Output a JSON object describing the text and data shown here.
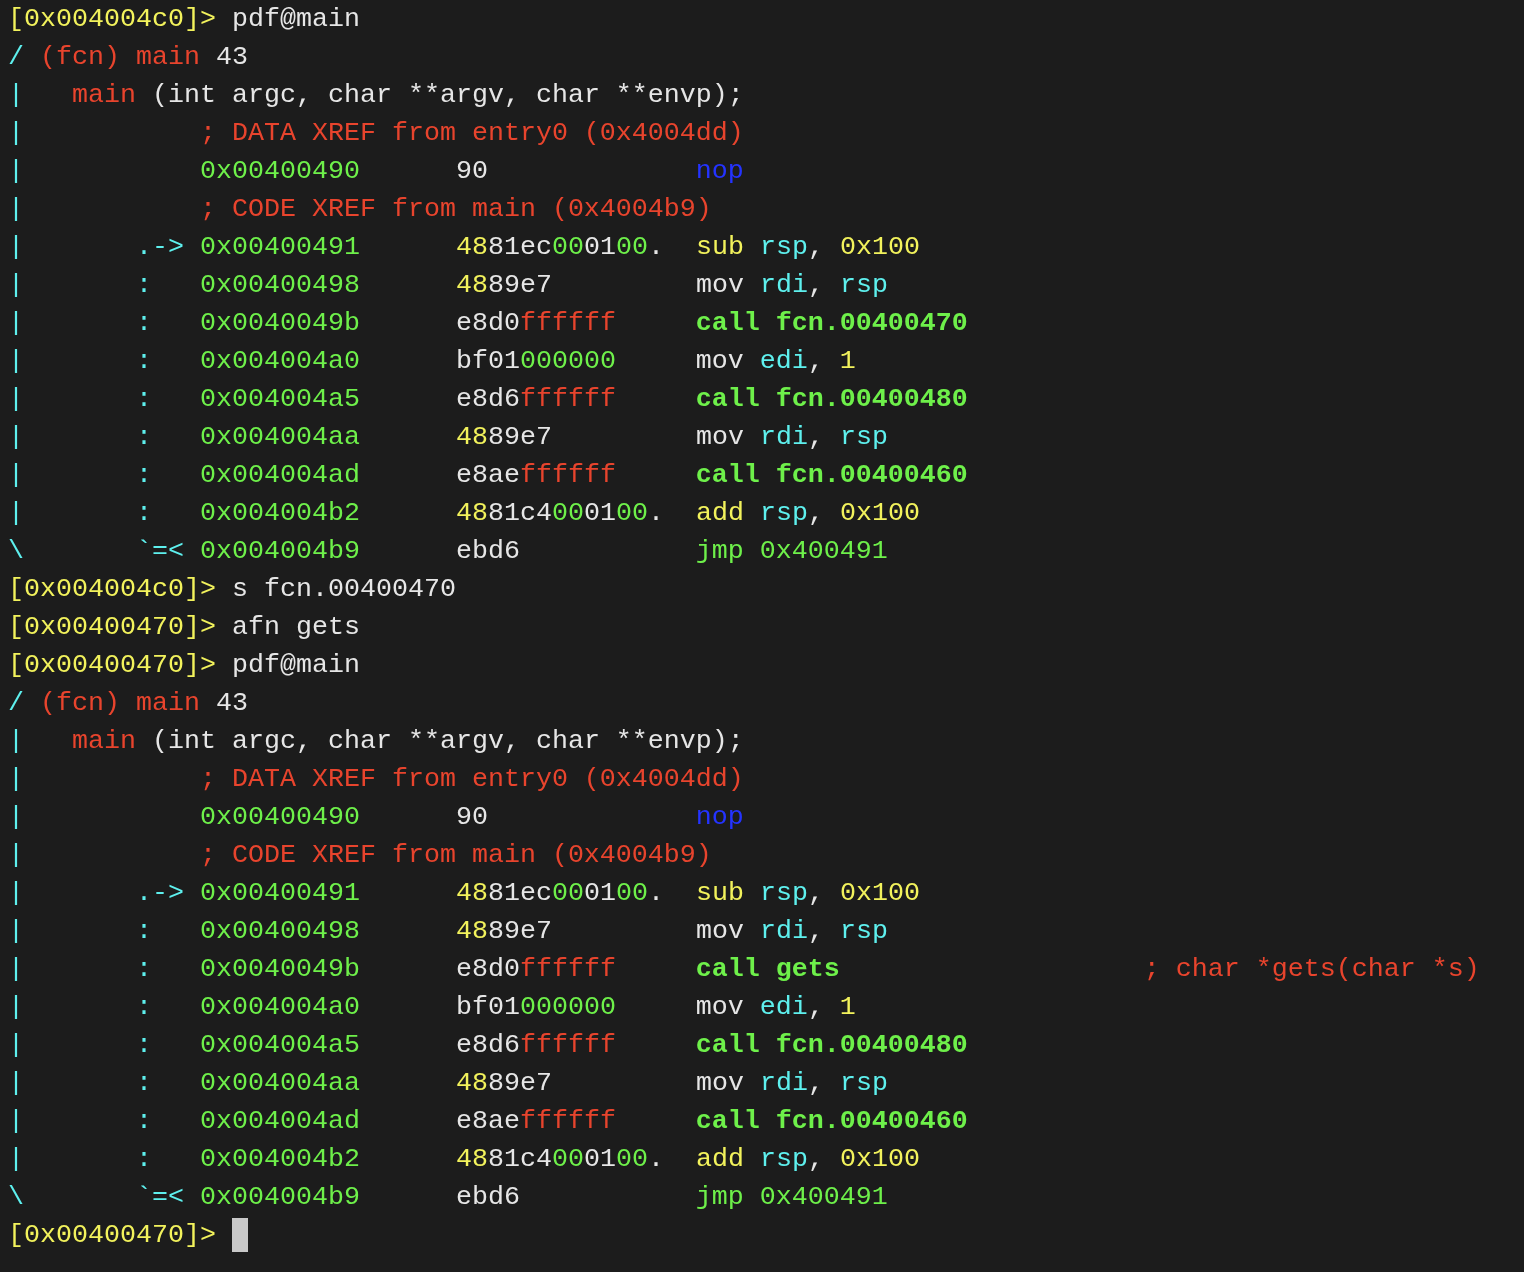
{
  "terminal": {
    "lines": [
      {
        "segments": [
          {
            "text": "[0x004004c0]>",
            "color": "#f2f25c"
          },
          {
            "text": " pdf@main",
            "color": "#e6e6e6"
          }
        ]
      },
      {
        "segments": [
          {
            "text": "/",
            "color": "#5ef0ee"
          },
          {
            "text": " (fcn) main",
            "color": "#e8442d"
          },
          {
            "text": " 43",
            "color": "#e6e6e6"
          }
        ]
      },
      {
        "segments": [
          {
            "text": "|",
            "color": "#5ef0ee"
          },
          {
            "text": "   main",
            "color": "#e8442d"
          },
          {
            "text": " (int argc, char **argv, char **envp);",
            "color": "#e6e6e6"
          }
        ]
      },
      {
        "segments": [
          {
            "text": "|",
            "color": "#5ef0ee"
          },
          {
            "text": "           ; DATA XREF from entry0 (0x4004dd)",
            "color": "#e8442d"
          }
        ]
      },
      {
        "segments": [
          {
            "text": "|",
            "color": "#5ef0ee"
          },
          {
            "text": "           0x00400490",
            "color": "#6ef04a"
          },
          {
            "text": "      90",
            "color": "#e6e6e6"
          },
          {
            "text": "             nop",
            "color": "#2433ff"
          }
        ]
      },
      {
        "segments": [
          {
            "text": "|",
            "color": "#5ef0ee"
          },
          {
            "text": "           ; CODE XREF from main (0x4004b9)",
            "color": "#e8442d"
          }
        ]
      },
      {
        "segments": [
          {
            "text": "|",
            "color": "#5ef0ee"
          },
          {
            "text": "       .->",
            "color": "#5ef0ee"
          },
          {
            "text": " 0x00400491",
            "color": "#6ef04a"
          },
          {
            "text": "      48",
            "color": "#f2f25c"
          },
          {
            "text": "81ec",
            "color": "#e6e6e6"
          },
          {
            "text": "00",
            "color": "#6ef04a"
          },
          {
            "text": "01",
            "color": "#e6e6e6"
          },
          {
            "text": "00",
            "color": "#6ef04a"
          },
          {
            "text": ".",
            "color": "#e6e6e6"
          },
          {
            "text": "  sub",
            "color": "#f2f25c"
          },
          {
            "text": " rsp",
            "color": "#5ef0ee"
          },
          {
            "text": ",",
            "color": "#e6e6e6"
          },
          {
            "text": " 0x100",
            "color": "#f2f25c"
          }
        ]
      },
      {
        "segments": [
          {
            "text": "|",
            "color": "#5ef0ee"
          },
          {
            "text": "       :",
            "color": "#5ef0ee"
          },
          {
            "text": "   0x00400498",
            "color": "#6ef04a"
          },
          {
            "text": "      48",
            "color": "#f2f25c"
          },
          {
            "text": "89e7",
            "color": "#e6e6e6"
          },
          {
            "text": "         mov",
            "color": "#e6e6e6"
          },
          {
            "text": " rdi",
            "color": "#5ef0ee"
          },
          {
            "text": ",",
            "color": "#e6e6e6"
          },
          {
            "text": " rsp",
            "color": "#5ef0ee"
          }
        ]
      },
      {
        "segments": [
          {
            "text": "|",
            "color": "#5ef0ee"
          },
          {
            "text": "       :",
            "color": "#5ef0ee"
          },
          {
            "text": "   0x0040049b",
            "color": "#6ef04a"
          },
          {
            "text": "      e8d0",
            "color": "#e6e6e6"
          },
          {
            "text": "ffffff",
            "color": "#e8442d"
          },
          {
            "text": "     call fcn.00400470",
            "color": "#6ef04a",
            "bold": true
          }
        ]
      },
      {
        "segments": [
          {
            "text": "|",
            "color": "#5ef0ee"
          },
          {
            "text": "       :",
            "color": "#5ef0ee"
          },
          {
            "text": "   0x004004a0",
            "color": "#6ef04a"
          },
          {
            "text": "      bf01",
            "color": "#e6e6e6"
          },
          {
            "text": "000000",
            "color": "#6ef04a"
          },
          {
            "text": "     mov",
            "color": "#e6e6e6"
          },
          {
            "text": " edi",
            "color": "#5ef0ee"
          },
          {
            "text": ",",
            "color": "#e6e6e6"
          },
          {
            "text": " 1",
            "color": "#f2f25c"
          }
        ]
      },
      {
        "segments": [
          {
            "text": "|",
            "color": "#5ef0ee"
          },
          {
            "text": "       :",
            "color": "#5ef0ee"
          },
          {
            "text": "   0x004004a5",
            "color": "#6ef04a"
          },
          {
            "text": "      e8d6",
            "color": "#e6e6e6"
          },
          {
            "text": "ffffff",
            "color": "#e8442d"
          },
          {
            "text": "     call fcn.00400480",
            "color": "#6ef04a",
            "bold": true
          }
        ]
      },
      {
        "segments": [
          {
            "text": "|",
            "color": "#5ef0ee"
          },
          {
            "text": "       :",
            "color": "#5ef0ee"
          },
          {
            "text": "   0x004004aa",
            "color": "#6ef04a"
          },
          {
            "text": "      48",
            "color": "#f2f25c"
          },
          {
            "text": "89e7",
            "color": "#e6e6e6"
          },
          {
            "text": "         mov",
            "color": "#e6e6e6"
          },
          {
            "text": " rdi",
            "color": "#5ef0ee"
          },
          {
            "text": ",",
            "color": "#e6e6e6"
          },
          {
            "text": " rsp",
            "color": "#5ef0ee"
          }
        ]
      },
      {
        "segments": [
          {
            "text": "|",
            "color": "#5ef0ee"
          },
          {
            "text": "       :",
            "color": "#5ef0ee"
          },
          {
            "text": "   0x004004ad",
            "color": "#6ef04a"
          },
          {
            "text": "      e8ae",
            "color": "#e6e6e6"
          },
          {
            "text": "ffffff",
            "color": "#e8442d"
          },
          {
            "text": "     call fcn.00400460",
            "color": "#6ef04a",
            "bold": true
          }
        ]
      },
      {
        "segments": [
          {
            "text": "|",
            "color": "#5ef0ee"
          },
          {
            "text": "       :",
            "color": "#5ef0ee"
          },
          {
            "text": "   0x004004b2",
            "color": "#6ef04a"
          },
          {
            "text": "      48",
            "color": "#f2f25c"
          },
          {
            "text": "81c4",
            "color": "#e6e6e6"
          },
          {
            "text": "00",
            "color": "#6ef04a"
          },
          {
            "text": "01",
            "color": "#e6e6e6"
          },
          {
            "text": "00",
            "color": "#6ef04a"
          },
          {
            "text": ".",
            "color": "#e6e6e6"
          },
          {
            "text": "  add",
            "color": "#f2f25c"
          },
          {
            "text": " rsp",
            "color": "#5ef0ee"
          },
          {
            "text": ",",
            "color": "#e6e6e6"
          },
          {
            "text": " 0x100",
            "color": "#f2f25c"
          }
        ]
      },
      {
        "segments": [
          {
            "text": "\\",
            "color": "#5ef0ee"
          },
          {
            "text": "       `=<",
            "color": "#5ef0ee"
          },
          {
            "text": " 0x004004b9",
            "color": "#6ef04a"
          },
          {
            "text": "      ebd6",
            "color": "#e6e6e6"
          },
          {
            "text": "           jmp 0x400491",
            "color": "#6ef04a"
          }
        ]
      },
      {
        "segments": [
          {
            "text": "[0x004004c0]>",
            "color": "#f2f25c"
          },
          {
            "text": " s fcn.00400470",
            "color": "#e6e6e6"
          }
        ]
      },
      {
        "segments": [
          {
            "text": "[0x00400470]>",
            "color": "#f2f25c"
          },
          {
            "text": " afn gets",
            "color": "#e6e6e6"
          }
        ]
      },
      {
        "segments": [
          {
            "text": "[0x00400470]>",
            "color": "#f2f25c"
          },
          {
            "text": " pdf@main",
            "color": "#e6e6e6"
          }
        ]
      },
      {
        "segments": [
          {
            "text": "/",
            "color": "#5ef0ee"
          },
          {
            "text": " (fcn) main",
            "color": "#e8442d"
          },
          {
            "text": " 43",
            "color": "#e6e6e6"
          }
        ]
      },
      {
        "segments": [
          {
            "text": "|",
            "color": "#5ef0ee"
          },
          {
            "text": "   main",
            "color": "#e8442d"
          },
          {
            "text": " (int argc, char **argv, char **envp);",
            "color": "#e6e6e6"
          }
        ]
      },
      {
        "segments": [
          {
            "text": "|",
            "color": "#5ef0ee"
          },
          {
            "text": "           ; DATA XREF from entry0 (0x4004dd)",
            "color": "#e8442d"
          }
        ]
      },
      {
        "segments": [
          {
            "text": "|",
            "color": "#5ef0ee"
          },
          {
            "text": "           0x00400490",
            "color": "#6ef04a"
          },
          {
            "text": "      90",
            "color": "#e6e6e6"
          },
          {
            "text": "             nop",
            "color": "#2433ff"
          }
        ]
      },
      {
        "segments": [
          {
            "text": "|",
            "color": "#5ef0ee"
          },
          {
            "text": "           ; CODE XREF from main (0x4004b9)",
            "color": "#e8442d"
          }
        ]
      },
      {
        "segments": [
          {
            "text": "|",
            "color": "#5ef0ee"
          },
          {
            "text": "       .->",
            "color": "#5ef0ee"
          },
          {
            "text": " 0x00400491",
            "color": "#6ef04a"
          },
          {
            "text": "      48",
            "color": "#f2f25c"
          },
          {
            "text": "81ec",
            "color": "#e6e6e6"
          },
          {
            "text": "00",
            "color": "#6ef04a"
          },
          {
            "text": "01",
            "color": "#e6e6e6"
          },
          {
            "text": "00",
            "color": "#6ef04a"
          },
          {
            "text": ".",
            "color": "#e6e6e6"
          },
          {
            "text": "  sub",
            "color": "#f2f25c"
          },
          {
            "text": " rsp",
            "color": "#5ef0ee"
          },
          {
            "text": ",",
            "color": "#e6e6e6"
          },
          {
            "text": " 0x100",
            "color": "#f2f25c"
          }
        ]
      },
      {
        "segments": [
          {
            "text": "|",
            "color": "#5ef0ee"
          },
          {
            "text": "       :",
            "color": "#5ef0ee"
          },
          {
            "text": "   0x00400498",
            "color": "#6ef04a"
          },
          {
            "text": "      48",
            "color": "#f2f25c"
          },
          {
            "text": "89e7",
            "color": "#e6e6e6"
          },
          {
            "text": "         mov",
            "color": "#e6e6e6"
          },
          {
            "text": " rdi",
            "color": "#5ef0ee"
          },
          {
            "text": ",",
            "color": "#e6e6e6"
          },
          {
            "text": " rsp",
            "color": "#5ef0ee"
          }
        ]
      },
      {
        "segments": [
          {
            "text": "|",
            "color": "#5ef0ee"
          },
          {
            "text": "       :",
            "color": "#5ef0ee"
          },
          {
            "text": "   0x0040049b",
            "color": "#6ef04a"
          },
          {
            "text": "      e8d0",
            "color": "#e6e6e6"
          },
          {
            "text": "ffffff",
            "color": "#e8442d"
          },
          {
            "text": "     call gets",
            "color": "#6ef04a",
            "bold": true
          },
          {
            "text": "                   ; char *gets(char *s)",
            "color": "#e8442d"
          }
        ]
      },
      {
        "segments": [
          {
            "text": "|",
            "color": "#5ef0ee"
          },
          {
            "text": "       :",
            "color": "#5ef0ee"
          },
          {
            "text": "   0x004004a0",
            "color": "#6ef04a"
          },
          {
            "text": "      bf01",
            "color": "#e6e6e6"
          },
          {
            "text": "000000",
            "color": "#6ef04a"
          },
          {
            "text": "     mov",
            "color": "#e6e6e6"
          },
          {
            "text": " edi",
            "color": "#5ef0ee"
          },
          {
            "text": ",",
            "color": "#e6e6e6"
          },
          {
            "text": " 1",
            "color": "#f2f25c"
          }
        ]
      },
      {
        "segments": [
          {
            "text": "|",
            "color": "#5ef0ee"
          },
          {
            "text": "       :",
            "color": "#5ef0ee"
          },
          {
            "text": "   0x004004a5",
            "color": "#6ef04a"
          },
          {
            "text": "      e8d6",
            "color": "#e6e6e6"
          },
          {
            "text": "ffffff",
            "color": "#e8442d"
          },
          {
            "text": "     call fcn.00400480",
            "color": "#6ef04a",
            "bold": true
          }
        ]
      },
      {
        "segments": [
          {
            "text": "|",
            "color": "#5ef0ee"
          },
          {
            "text": "       :",
            "color": "#5ef0ee"
          },
          {
            "text": "   0x004004aa",
            "color": "#6ef04a"
          },
          {
            "text": "      48",
            "color": "#f2f25c"
          },
          {
            "text": "89e7",
            "color": "#e6e6e6"
          },
          {
            "text": "         mov",
            "color": "#e6e6e6"
          },
          {
            "text": " rdi",
            "color": "#5ef0ee"
          },
          {
            "text": ",",
            "color": "#e6e6e6"
          },
          {
            "text": " rsp",
            "color": "#5ef0ee"
          }
        ]
      },
      {
        "segments": [
          {
            "text": "|",
            "color": "#5ef0ee"
          },
          {
            "text": "       :",
            "color": "#5ef0ee"
          },
          {
            "text": "   0x004004ad",
            "color": "#6ef04a"
          },
          {
            "text": "      e8ae",
            "color": "#e6e6e6"
          },
          {
            "text": "ffffff",
            "color": "#e8442d"
          },
          {
            "text": "     call fcn.00400460",
            "color": "#6ef04a",
            "bold": true
          }
        ]
      },
      {
        "segments": [
          {
            "text": "|",
            "color": "#5ef0ee"
          },
          {
            "text": "       :",
            "color": "#5ef0ee"
          },
          {
            "text": "   0x004004b2",
            "color": "#6ef04a"
          },
          {
            "text": "      48",
            "color": "#f2f25c"
          },
          {
            "text": "81c4",
            "color": "#e6e6e6"
          },
          {
            "text": "00",
            "color": "#6ef04a"
          },
          {
            "text": "01",
            "color": "#e6e6e6"
          },
          {
            "text": "00",
            "color": "#6ef04a"
          },
          {
            "text": ".",
            "color": "#e6e6e6"
          },
          {
            "text": "  add",
            "color": "#f2f25c"
          },
          {
            "text": " rsp",
            "color": "#5ef0ee"
          },
          {
            "text": ",",
            "color": "#e6e6e6"
          },
          {
            "text": " 0x100",
            "color": "#f2f25c"
          }
        ]
      },
      {
        "segments": [
          {
            "text": "\\",
            "color": "#5ef0ee"
          },
          {
            "text": "       `=<",
            "color": "#5ef0ee"
          },
          {
            "text": " 0x004004b9",
            "color": "#6ef04a"
          },
          {
            "text": "      ebd6",
            "color": "#e6e6e6"
          },
          {
            "text": "           jmp 0x400491",
            "color": "#6ef04a"
          }
        ]
      },
      {
        "segments": [
          {
            "text": "[0x00400470]>",
            "color": "#f2f25c"
          }
        ],
        "cursor": true
      }
    ]
  }
}
